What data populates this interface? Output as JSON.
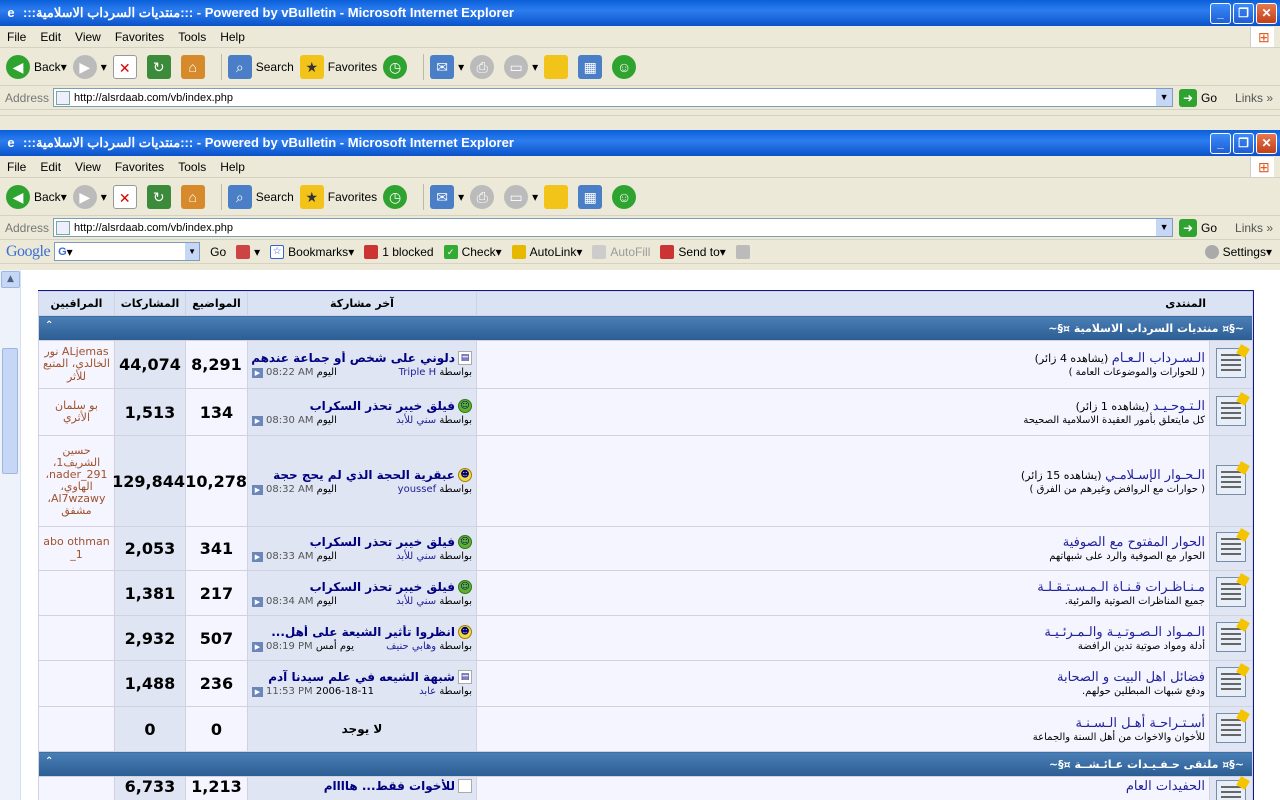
{
  "window": {
    "title": ":::منتديات السرداب الاسلامية::: - Powered by vBulletin - Microsoft Internet Explorer",
    "menu": [
      "File",
      "Edit",
      "View",
      "Favorites",
      "Tools",
      "Help"
    ],
    "toolbar": {
      "back": "Back",
      "search": "Search",
      "favorites": "Favorites"
    },
    "address": {
      "label": "Address",
      "url": "http://alsrdaab.com/vb/index.php",
      "go": "Go",
      "links": "Links"
    },
    "google": {
      "logo": "Google",
      "go": "Go",
      "bookmarks": "Bookmarks",
      "blocked": "1 blocked",
      "check": "Check",
      "autolink": "AutoLink",
      "autofill": "AutoFill",
      "sendto": "Send to",
      "settings": "Settings"
    }
  },
  "forum": {
    "headers": {
      "forum": "المنتدى",
      "last_post": "آخر مشاركة",
      "threads": "المواضيع",
      "posts": "المشاركات",
      "moderators": "المراقبين"
    },
    "categories": [
      {
        "title": "~§¤ منتديات السرداب الاسلامية ¤§~"
      },
      {
        "title": "~§¤ ملتقى حـفـيـدات عـائـشــة ¤§~"
      }
    ],
    "rows": [
      {
        "name": "الـسـرداب الـعـام",
        "viewing": "(يشاهده 4 زائر)",
        "desc": "( للحوارات والموضوعات العامة )",
        "last_title": "دلوني على شخص أو جماعة عندهم...",
        "last_by_label": "بواسطة",
        "last_by": "Triple H",
        "last_day": "اليوم",
        "last_time": "08:22 AM",
        "icon": "page",
        "threads": "8,291",
        "posts": "44,074",
        "mods": "ALjemas نور الخالدي، المتبع للأثر"
      },
      {
        "name": "الـتـوحـيـد",
        "viewing": "(يشاهده 1 زائر)",
        "desc": "كل مايتعلق بأمور العقيدة الاسلامية الصحيحة",
        "last_title": "فيلق خيبر تحذر السكراب",
        "last_by_label": "بواسطة",
        "last_by": "سني للأبد",
        "last_day": "اليوم",
        "last_time": "08:30 AM",
        "icon": "smile",
        "threads": "134",
        "posts": "1,513",
        "mods": "بو سلمان الأثري"
      },
      {
        "name": "الـحـوار الإسـلامـي",
        "viewing": "(يشاهده 15 زائر)",
        "desc": "( حوارات مع الروافض وغيرهم من الفرق )",
        "last_title": "عبقرية الحجة الذي لم يحج حجة",
        "last_by_label": "بواسطة",
        "last_by": "youssef",
        "last_day": "اليوم",
        "last_time": "08:32 AM",
        "icon": "cool",
        "threads": "10,278",
        "posts": "129,844",
        "mods": "حسين الشريف1، nader_291، الهاوي، Al7wzawy، مشفق"
      },
      {
        "name": "الحوار المفتوح مع الصوفية",
        "viewing": "",
        "desc": "الحوار مع الصوفية والرد على شبهاتهم",
        "last_title": "فيلق خيبر تحذر السكراب",
        "last_by_label": "بواسطة",
        "last_by": "سني للأبد",
        "last_day": "اليوم",
        "last_time": "08:33 AM",
        "icon": "smile",
        "threads": "341",
        "posts": "2,053",
        "mods": "abo othman 1_"
      },
      {
        "name": "مـنـاظـرات قـنـاة الـمـسـتـقـلـة",
        "viewing": "",
        "desc": "جميع المناظرات الصوتية والمرئية.",
        "last_title": "فيلق خيبر تحذر السكراب",
        "last_by_label": "بواسطة",
        "last_by": "سني للأبد",
        "last_day": "اليوم",
        "last_time": "08:34 AM",
        "icon": "smile",
        "threads": "217",
        "posts": "1,381",
        "mods": ""
      },
      {
        "name": "الـمـواد الـصـوتـيـة والـمـرئـيـة",
        "viewing": "",
        "desc": "أدلة ومواد صوتية تدين الرافضة",
        "last_title": "انظروا تأثير الشيعة على أهل...",
        "last_by_label": "بواسطة",
        "last_by": "وهابي حنيف",
        "last_day": "يوم أمس",
        "last_time": "08:19 PM",
        "icon": "cool",
        "threads": "507",
        "posts": "2,932",
        "mods": ""
      },
      {
        "name": "فضائل اهل البيت و الصحابة",
        "viewing": "",
        "desc": "ودفع شبهات المبطلين حولهم.",
        "last_title": "شبهة الشيعه في علم سيدنا آدم",
        "last_by_label": "بواسطة",
        "last_by": "عابد",
        "last_day": "2006-18-11",
        "last_time": "11:53 PM",
        "icon": "page",
        "threads": "236",
        "posts": "1,488",
        "mods": ""
      },
      {
        "name": "أسـتـراحـة أهـل الـسـنـة",
        "viewing": "",
        "desc": "للأخوان والاخوات من أهل السنة والجماعة",
        "last_title": "",
        "last_by_label": "",
        "last_by": "",
        "last_day": "",
        "last_time": "",
        "none": "لا يوجد",
        "icon": "page",
        "threads": "0",
        "posts": "0",
        "mods": ""
      }
    ],
    "partial_row": {
      "name": "الحفيدات العام",
      "last_title": "للأخوات فقط... هاااام",
      "threads": "1,213",
      "posts": "6,733"
    }
  }
}
